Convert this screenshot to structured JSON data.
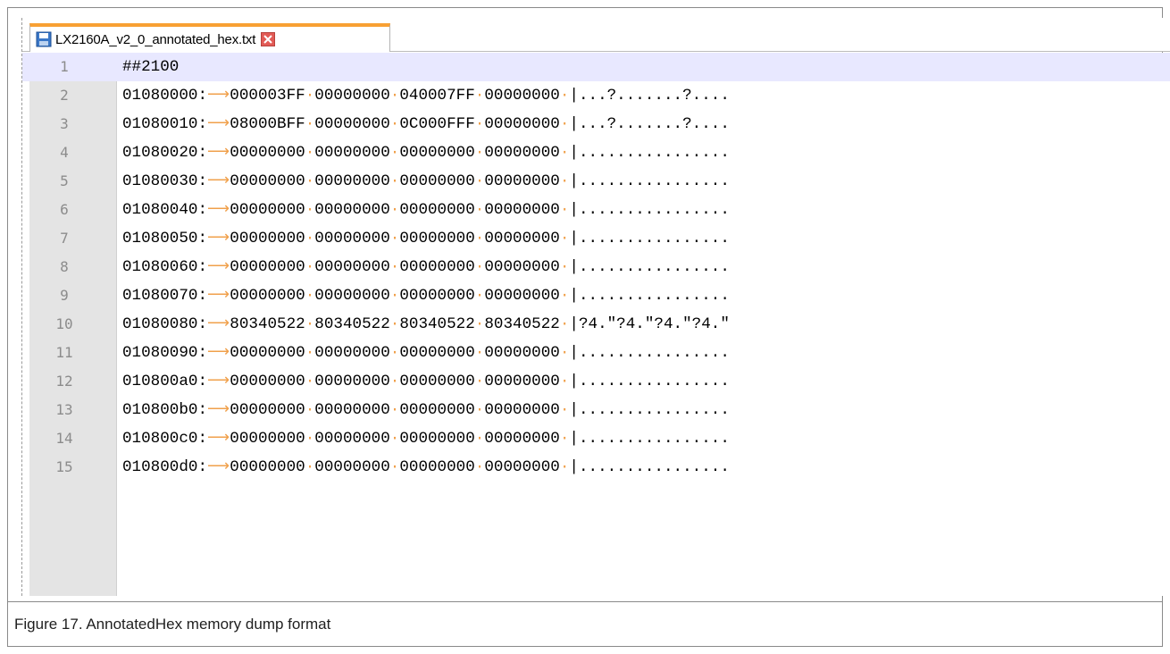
{
  "tab": {
    "filename": "LX2160A_v2_0_annotated_hex.txt",
    "icon": "save-icon",
    "close_icon": "close-icon",
    "accent_color": "#f8a033"
  },
  "editor": {
    "current_line": 1,
    "lines": [
      {
        "num": "1",
        "addr": "",
        "words": [],
        "ascii": "",
        "raw": "##2100"
      },
      {
        "num": "2",
        "addr": "01080000:",
        "words": [
          "000003FF",
          "00000000",
          "040007FF",
          "00000000"
        ],
        "ascii": "|...?.......?...."
      },
      {
        "num": "3",
        "addr": "01080010:",
        "words": [
          "08000BFF",
          "00000000",
          "0C000FFF",
          "00000000"
        ],
        "ascii": "|...?.......?...."
      },
      {
        "num": "4",
        "addr": "01080020:",
        "words": [
          "00000000",
          "00000000",
          "00000000",
          "00000000"
        ],
        "ascii": "|................"
      },
      {
        "num": "5",
        "addr": "01080030:",
        "words": [
          "00000000",
          "00000000",
          "00000000",
          "00000000"
        ],
        "ascii": "|................"
      },
      {
        "num": "6",
        "addr": "01080040:",
        "words": [
          "00000000",
          "00000000",
          "00000000",
          "00000000"
        ],
        "ascii": "|................"
      },
      {
        "num": "7",
        "addr": "01080050:",
        "words": [
          "00000000",
          "00000000",
          "00000000",
          "00000000"
        ],
        "ascii": "|................"
      },
      {
        "num": "8",
        "addr": "01080060:",
        "words": [
          "00000000",
          "00000000",
          "00000000",
          "00000000"
        ],
        "ascii": "|................"
      },
      {
        "num": "9",
        "addr": "01080070:",
        "words": [
          "00000000",
          "00000000",
          "00000000",
          "00000000"
        ],
        "ascii": "|................"
      },
      {
        "num": "10",
        "addr": "01080080:",
        "words": [
          "80340522",
          "80340522",
          "80340522",
          "80340522"
        ],
        "ascii": "|?4.\"?4.\"?4.\"?4.\""
      },
      {
        "num": "11",
        "addr": "01080090:",
        "words": [
          "00000000",
          "00000000",
          "00000000",
          "00000000"
        ],
        "ascii": "|................"
      },
      {
        "num": "12",
        "addr": "010800a0:",
        "words": [
          "00000000",
          "00000000",
          "00000000",
          "00000000"
        ],
        "ascii": "|................"
      },
      {
        "num": "13",
        "addr": "010800b0:",
        "words": [
          "00000000",
          "00000000",
          "00000000",
          "00000000"
        ],
        "ascii": "|................"
      },
      {
        "num": "14",
        "addr": "010800c0:",
        "words": [
          "00000000",
          "00000000",
          "00000000",
          "00000000"
        ],
        "ascii": "|................"
      },
      {
        "num": "15",
        "addr": "010800d0:",
        "words": [
          "00000000",
          "00000000",
          "00000000",
          "00000000"
        ],
        "ascii": "|................"
      }
    ],
    "whitespace_color": "#f0a04b",
    "current_line_color": "#e8e8ff"
  },
  "caption": {
    "text": "Figure 17. AnnotatedHex memory dump format"
  }
}
